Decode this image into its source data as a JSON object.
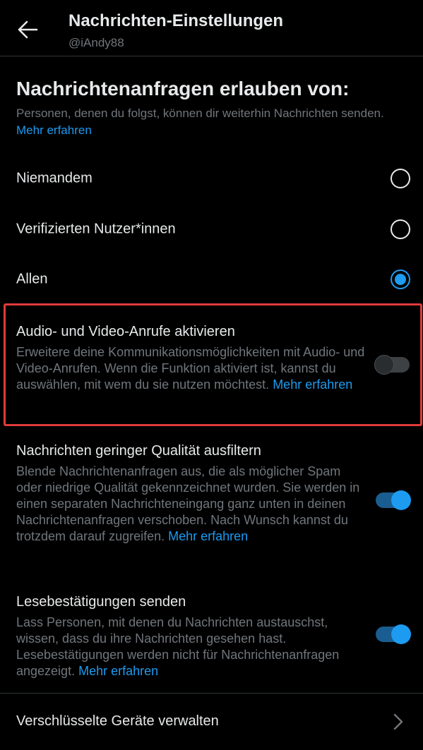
{
  "header": {
    "title": "Nachrichten-Einstellungen",
    "handle": "@iAndy88"
  },
  "message_requests": {
    "title": "Nachrichtenanfragen erlauben von:",
    "description": "Personen, denen du folgst, können dir weiterhin Nachrichten senden.",
    "link": "Mehr erfahren",
    "options": [
      {
        "label": "Niemandem",
        "selected": false
      },
      {
        "label": "Verifizierten Nutzer*innen",
        "selected": false
      },
      {
        "label": "Allen",
        "selected": true
      }
    ]
  },
  "calls": {
    "title": "Audio- und Video-Anrufe aktivieren",
    "description": "Erweitere deine Kommunikationsmöglichkeiten mit Audio- und Video-Anrufen. Wenn die Funktion aktiviert ist, kannst du auswählen, mit wem du sie nutzen möchtest.",
    "link": "Mehr erfahren",
    "enabled": false
  },
  "quality_filter": {
    "title": "Nachrichten geringer Qualität ausfiltern",
    "description": "Blende Nachrichtenanfragen aus, die als möglicher Spam oder niedrige Qualität gekennzeichnet wurden. Sie werden in einen separaten Nachrichteneingang ganz unten in deinen Nachrichtenanfragen verschoben. Nach Wunsch kannst du trotzdem darauf zugreifen.",
    "link": "Mehr erfahren",
    "enabled": true
  },
  "read_receipts": {
    "title": "Lesebestätigungen senden",
    "description": "Lass Personen, mit denen du Nachrichten austauschst, wissen, dass du ihre Nachrichten gesehen hast. Lesebestätigungen werden nicht für Nachrichtenanfragen angezeigt.",
    "link": "Mehr erfahren",
    "enabled": true
  },
  "devices": {
    "label": "Verschlüsselte Geräte verwalten"
  },
  "colors": {
    "accent": "#1d9bf0",
    "highlight": "#e03b3b"
  }
}
